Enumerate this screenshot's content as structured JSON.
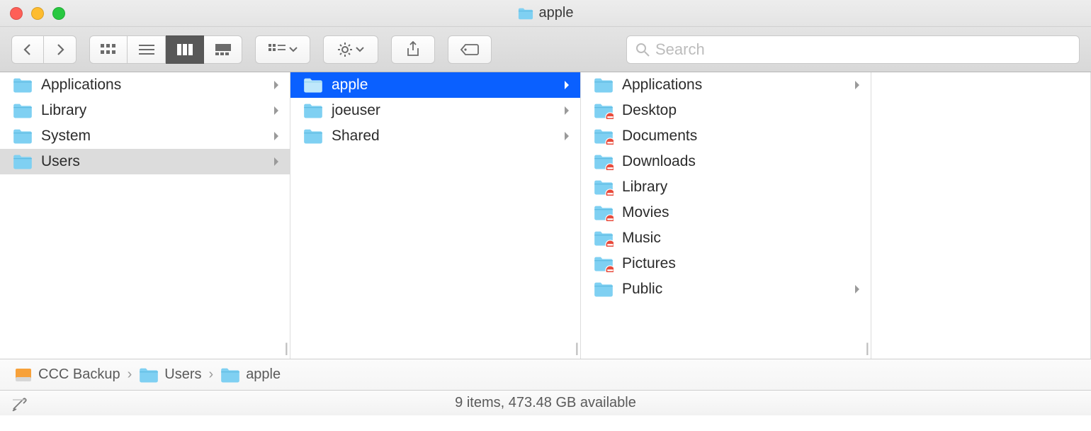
{
  "window": {
    "title": "apple"
  },
  "search": {
    "placeholder": "Search"
  },
  "columns": [
    {
      "items": [
        {
          "label": "Applications",
          "hasChildren": true,
          "state": "normal",
          "restricted": false
        },
        {
          "label": "Library",
          "hasChildren": true,
          "state": "normal",
          "restricted": false
        },
        {
          "label": "System",
          "hasChildren": true,
          "state": "normal",
          "restricted": false
        },
        {
          "label": "Users",
          "hasChildren": true,
          "state": "path",
          "restricted": false
        }
      ]
    },
    {
      "items": [
        {
          "label": "apple",
          "hasChildren": true,
          "state": "selected",
          "restricted": false
        },
        {
          "label": "joeuser",
          "hasChildren": true,
          "state": "normal",
          "restricted": false
        },
        {
          "label": "Shared",
          "hasChildren": true,
          "state": "normal",
          "restricted": false
        }
      ]
    },
    {
      "items": [
        {
          "label": "Applications",
          "hasChildren": true,
          "state": "normal",
          "restricted": false
        },
        {
          "label": "Desktop",
          "hasChildren": false,
          "state": "normal",
          "restricted": true
        },
        {
          "label": "Documents",
          "hasChildren": false,
          "state": "normal",
          "restricted": true
        },
        {
          "label": "Downloads",
          "hasChildren": false,
          "state": "normal",
          "restricted": true
        },
        {
          "label": "Library",
          "hasChildren": false,
          "state": "normal",
          "restricted": true
        },
        {
          "label": "Movies",
          "hasChildren": false,
          "state": "normal",
          "restricted": true
        },
        {
          "label": "Music",
          "hasChildren": false,
          "state": "normal",
          "restricted": true
        },
        {
          "label": "Pictures",
          "hasChildren": false,
          "state": "normal",
          "restricted": true
        },
        {
          "label": "Public",
          "hasChildren": true,
          "state": "normal",
          "restricted": false
        }
      ]
    }
  ],
  "path": [
    {
      "label": "CCC Backup",
      "icon": "disk"
    },
    {
      "label": "Users",
      "icon": "folder"
    },
    {
      "label": "apple",
      "icon": "folder"
    }
  ],
  "status": {
    "text": "9 items, 473.48 GB available"
  }
}
